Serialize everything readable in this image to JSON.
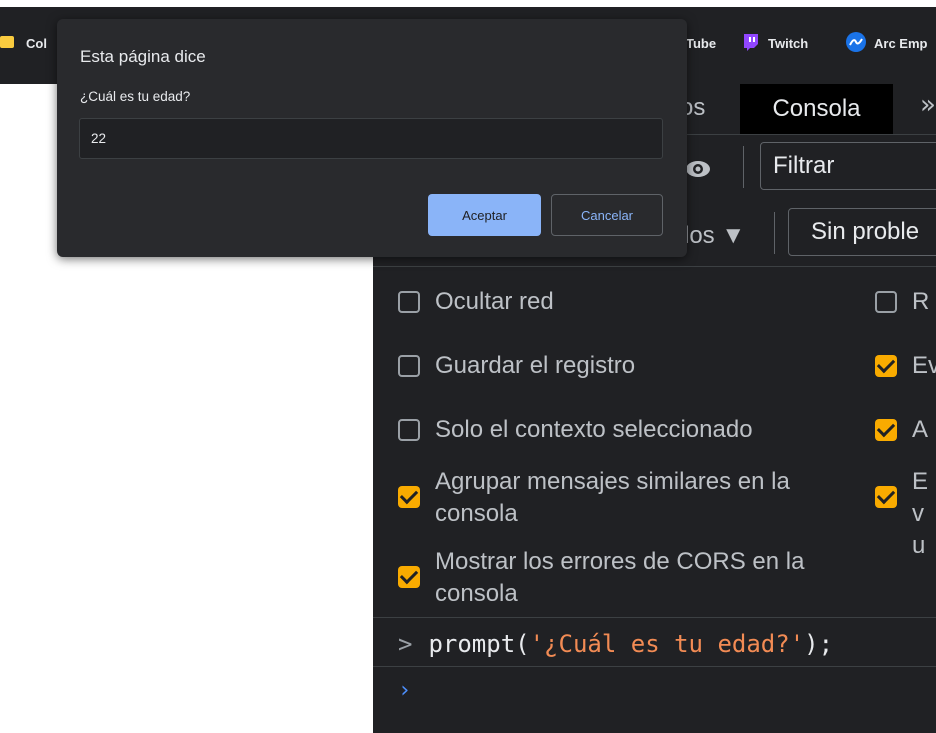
{
  "bookmarks": {
    "items": [
      {
        "label": "Col"
      },
      {
        "label": "Tube"
      },
      {
        "label": "Twitch"
      },
      {
        "label": "Arc Emp"
      }
    ]
  },
  "devtools": {
    "tab_prev_label": "os",
    "tab_active_label": "Consola",
    "tab_more_label": "»",
    "filter_placeholder": "Filtrar",
    "levels_label": "los ▼",
    "issues_label": "Sin proble",
    "settings": [
      {
        "label": "Ocultar red",
        "checked": false
      },
      {
        "label": "Guardar el registro",
        "checked": false
      },
      {
        "label": "Solo el contexto seleccionado",
        "checked": false
      },
      {
        "label": "Agrupar mensajes similares en la consola",
        "checked": true
      },
      {
        "label": "Mostrar los errores de CORS en la consola",
        "checked": true
      },
      {
        "label": "R",
        "checked": false
      },
      {
        "label": "Ev",
        "checked": true
      },
      {
        "label": "A",
        "checked": true
      },
      {
        "label": "Ev u",
        "checked": true
      }
    ],
    "console": {
      "command_prefix": "prompt(",
      "command_string": "'¿Cuál es tu edad?'",
      "command_suffix": ");",
      "input_arrow": "›",
      "history_arrow": ">"
    }
  },
  "dialog": {
    "title": "Esta página dice",
    "message": "¿Cuál es tu edad?",
    "input_value": "22",
    "ok_label": "Aceptar",
    "cancel_label": "Cancelar"
  },
  "colors": {
    "accent": "#8ab4f8",
    "checkbox_on": "#f9ab00",
    "console_string": "#f28b54",
    "panel_bg": "#202124",
    "dialog_bg": "#292a2d"
  }
}
